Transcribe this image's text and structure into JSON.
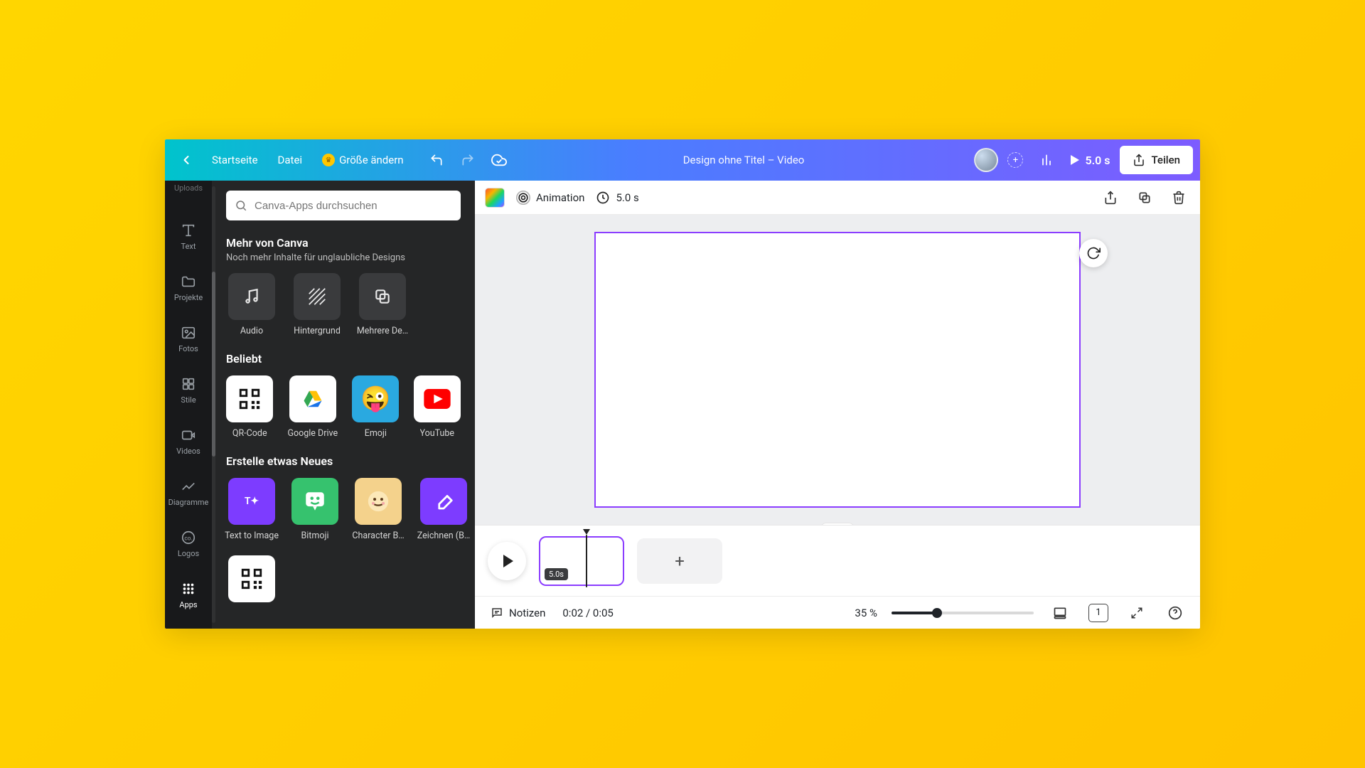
{
  "topbar": {
    "home": "Startseite",
    "file": "Datei",
    "resize": "Größe ändern",
    "title": "Design ohne Titel – Video",
    "duration": "5.0 s",
    "share": "Teilen"
  },
  "rail": {
    "uploads": "Uploads",
    "text": "Text",
    "projects": "Projekte",
    "photos": "Fotos",
    "styles": "Stile",
    "videos": "Videos",
    "charts": "Diagramme",
    "logos": "Logos",
    "apps": "Apps"
  },
  "panel": {
    "search_placeholder": "Canva-Apps durchsuchen",
    "more_title": "Mehr von Canva",
    "more_sub": "Noch mehr Inhalte für unglaubliche Designs",
    "more_items": {
      "audio": "Audio",
      "background": "Hintergrund",
      "multidesign": "Mehrere De…"
    },
    "popular_title": "Beliebt",
    "popular_items": {
      "qr": "QR-Code",
      "gdrive": "Google Drive",
      "emoji": "Emoji",
      "youtube": "YouTube"
    },
    "create_title": "Erstelle etwas Neues",
    "create_items": {
      "tti": "Text to Image",
      "bitmoji": "Bitmoji",
      "charb": "Character B…",
      "draw": "Zeichnen (B…"
    }
  },
  "context": {
    "animation": "Animation",
    "duration": "5.0 s"
  },
  "timeline": {
    "clip_badge": "5.0s"
  },
  "status": {
    "notes": "Notizen",
    "time": "0:02 / 0:05",
    "zoom": "35 %",
    "page_num": "1"
  }
}
